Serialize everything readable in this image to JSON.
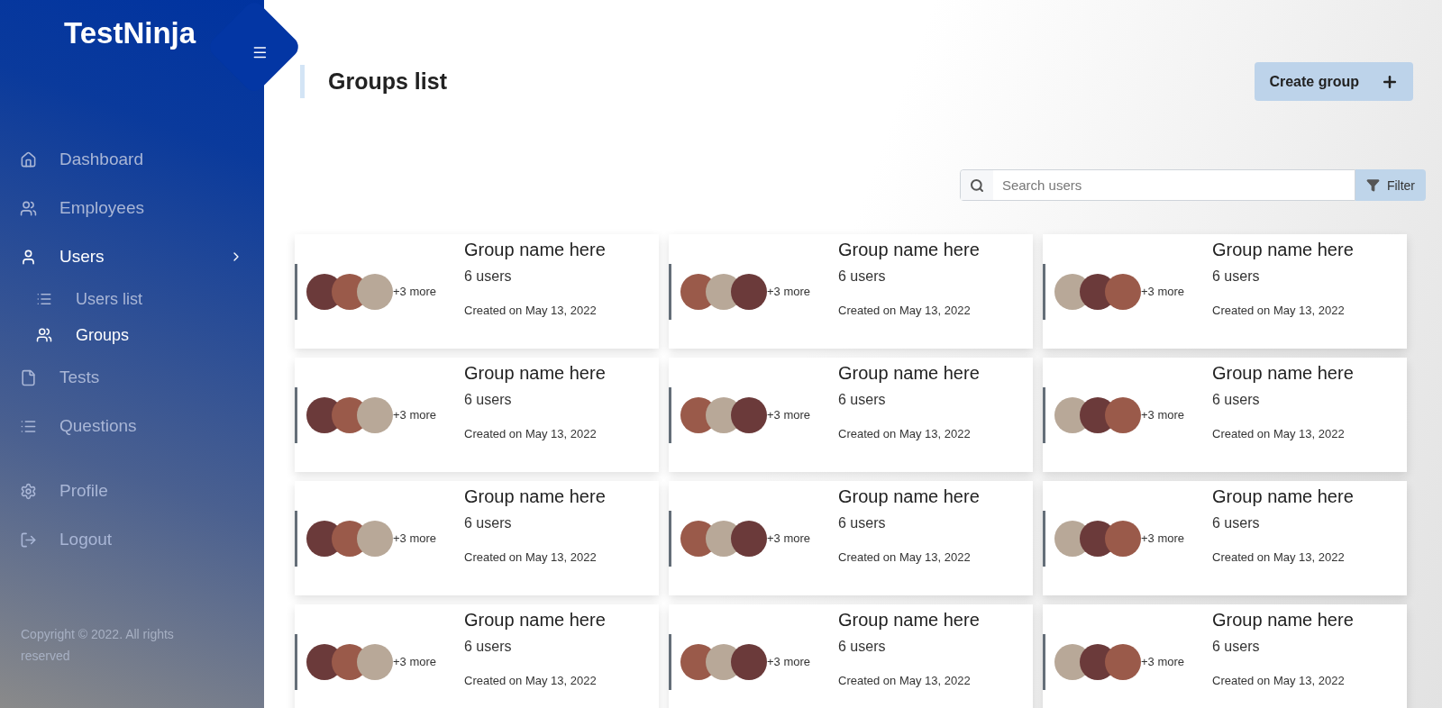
{
  "sidebar": {
    "logo": "TestNinja",
    "items": [
      {
        "kind": "home",
        "label": "Dashboard",
        "selected": false
      },
      {
        "kind": "people",
        "label": "Employees",
        "selected": false
      },
      {
        "kind": "person",
        "label": "Users",
        "selected": true,
        "expanded": true,
        "children": [
          {
            "kind": "list",
            "label": "Users list",
            "selected": false
          },
          {
            "kind": "people",
            "label": "Groups",
            "selected": true
          }
        ]
      },
      {
        "kind": "file",
        "label": "Tests",
        "selected": false
      },
      {
        "kind": "list",
        "label": "Questions",
        "selected": false
      }
    ],
    "account_items": [
      {
        "kind": "gear",
        "label": "Profile",
        "selected": false
      },
      {
        "kind": "logout",
        "label": "Logout",
        "selected": false
      }
    ],
    "copyright": "Copyright © 2022. All rights reserved"
  },
  "header": {
    "title": "Groups list",
    "create_button": "Create group"
  },
  "search": {
    "placeholder": "Search users",
    "filter_button": "Filter"
  },
  "groups": [
    {
      "name": "Group name here",
      "users": "6 users",
      "more": "+3 more",
      "created": "Created on May 13, 2022"
    },
    {
      "name": "Group name here",
      "users": "6 users",
      "more": "+3 more",
      "created": "Created on May 13, 2022"
    },
    {
      "name": "Group name here",
      "users": "6 users",
      "more": "+3 more",
      "created": "Created on May 13, 2022"
    },
    {
      "name": "Group name here",
      "users": "6 users",
      "more": "+3 more",
      "created": "Created on May 13, 2022"
    },
    {
      "name": "Group name here",
      "users": "6 users",
      "more": "+3 more",
      "created": "Created on May 13, 2022"
    },
    {
      "name": "Group name here",
      "users": "6 users",
      "more": "+3 more",
      "created": "Created on May 13, 2022"
    },
    {
      "name": "Group name here",
      "users": "6 users",
      "more": "+3 more",
      "created": "Created on May 13, 2022"
    },
    {
      "name": "Group name here",
      "users": "6 users",
      "more": "+3 more",
      "created": "Created on May 13, 2022"
    },
    {
      "name": "Group name here",
      "users": "6 users",
      "more": "+3 more",
      "created": "Created on May 13, 2022"
    },
    {
      "name": "Group name here",
      "users": "6 users",
      "more": "+3 more",
      "created": "Created on May 13, 2022"
    },
    {
      "name": "Group name here",
      "users": "6 users",
      "more": "+3 more",
      "created": "Created on May 13, 2022"
    },
    {
      "name": "Group name here",
      "users": "6 users",
      "more": "+3 more",
      "created": "Created on May 13, 2022"
    }
  ]
}
